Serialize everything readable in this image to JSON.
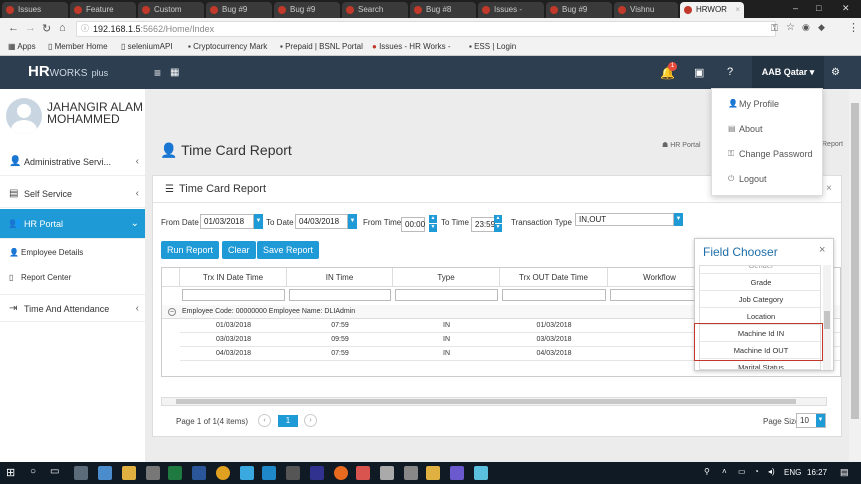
{
  "browser": {
    "tabs": [
      "Issues",
      "Feature",
      "Custom",
      "Bug #9",
      "Bug #9",
      "Search",
      "Bug #8",
      "Issues -",
      "Bug #9",
      "Vishnu",
      "HRWOR"
    ],
    "url_host": "192.168.1.5",
    "url_rest": ":5662/Home/Index",
    "bookmarks": [
      "Apps",
      "Member Home",
      "seleniumAPI",
      "Cryptocurrency Mark",
      "Prepaid | BSNL Portal",
      "Issues - HR Works -",
      "ESS | Login"
    ]
  },
  "app": {
    "logo_hr": "HR",
    "logo_works": "WORKS",
    "logo_plus": "plus",
    "notification_count": "1",
    "user_menu": "AAB Qatar ▾",
    "dropdown": [
      "My Profile",
      "About",
      "Change Password",
      "Logout"
    ]
  },
  "sidebar": {
    "user_name_line1": "JAHANGIR ALAM",
    "user_name_line2": "MOHAMMED",
    "items": [
      "Administrative Servi...",
      "Self Service",
      "HR Portal",
      "Time And Attendance"
    ],
    "subitems": [
      "Employee Details",
      "Report Center"
    ]
  },
  "page": {
    "title": "Time Card Report",
    "breadcrumb": "HR Portal",
    "breadcrumb_tail": "Report",
    "panel_title": "Time Card Report"
  },
  "filters": {
    "from_date_label": "From Date",
    "from_date": "01/03/2018",
    "to_date_label": "To Date",
    "to_date": "04/03/2018",
    "from_time_label": "From Time",
    "from_time": "00:00",
    "to_time_label": "To Time",
    "to_time": "23:59",
    "transaction_type_label": "Transaction Type",
    "transaction_type": "IN,OUT"
  },
  "actions": {
    "run_report": "Run Report",
    "clear": "Clear",
    "save_report": "Save Report"
  },
  "grid": {
    "columns": [
      "Trx IN Date Time",
      "IN Time",
      "Type",
      "Trx OUT Date Time",
      "Workflow"
    ],
    "group_label": "Employee Code: 00000000 Employee Name: DLIAdmin",
    "rows": [
      [
        "01/03/2018",
        "07:59",
        "IN",
        "01/03/2018"
      ],
      [
        "03/03/2018",
        "09:59",
        "IN",
        "03/03/2018"
      ],
      [
        "04/03/2018",
        "07:59",
        "IN",
        "04/03/2018"
      ]
    ]
  },
  "pager": {
    "summary": "Page 1 of 1(4 items)",
    "current_page": "1",
    "page_size_label": "Page Size",
    "page_size": "10"
  },
  "field_chooser": {
    "title": "Field Chooser",
    "items": [
      "Gender",
      "Grade",
      "Job Category",
      "Location",
      "Machine Id IN",
      "Machine Id OUT",
      "Marital Status"
    ]
  },
  "taskbar": {
    "language": "ENG",
    "time": "16:27"
  },
  "colors": {
    "accent": "#1e9ad6",
    "topnav": "#2c3e50",
    "highlight_border": "#c0392b"
  }
}
